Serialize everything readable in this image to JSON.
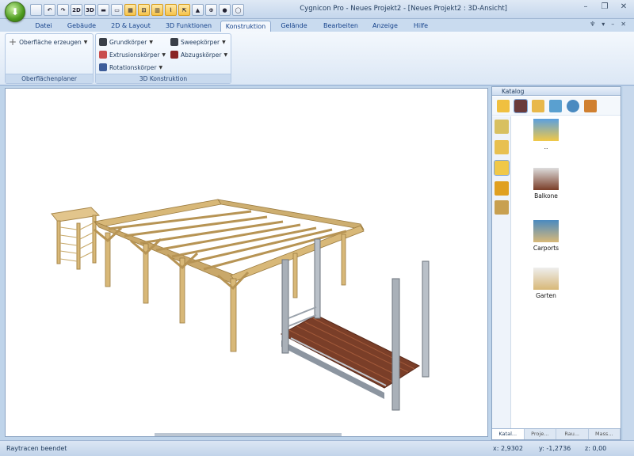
{
  "window": {
    "title": "Cygnicon Pro - Neues Projekt2 - [Neues Projekt2 : 3D-Ansicht]",
    "controls": [
      "–",
      "❐",
      "✕"
    ]
  },
  "qat": [
    "",
    "↶",
    "↷",
    "2D",
    "3D",
    "▬",
    "▭",
    "▦",
    "⊡",
    "▥",
    "⌇",
    "⇱",
    "▲",
    "⊕",
    "●",
    "◯"
  ],
  "tabs": [
    "Datei",
    "Gebäude",
    "2D & Layout",
    "3D Funktionen",
    "Konstruktion",
    "Gelände",
    "Bearbeiten",
    "Anzeige",
    "Hilfe"
  ],
  "active_tab": "Konstruktion",
  "help_icons": [
    "♆",
    "▾",
    "–",
    "✕"
  ],
  "ribbon": {
    "group1": {
      "label": "Oberflächenplaner",
      "button": "Oberfläche erzeugen"
    },
    "group2": {
      "label": "3D Konstruktion",
      "buttons": [
        "Grundkörper",
        "Extrusionskörper",
        "Rotationskörper",
        "Sweepkörper",
        "Abzugskörper"
      ]
    }
  },
  "catalog": {
    "title": "Katalog",
    "items": [
      {
        "label": ".."
      },
      {
        "label": "Balkone"
      },
      {
        "label": "Carports"
      },
      {
        "label": "Garten"
      }
    ],
    "tabs": [
      "Katal...",
      "Proje...",
      "Rau...",
      "Mass..."
    ]
  },
  "status": {
    "message": "Raytracen beendet",
    "x": "x: 2,9302",
    "y": "y: -1,2736",
    "z": "z: 0,00"
  },
  "colors": {
    "wood": "#d8b878",
    "wood_dark": "#a8874a",
    "metal": "#a9b0b8",
    "deck": "#8a4a30"
  }
}
